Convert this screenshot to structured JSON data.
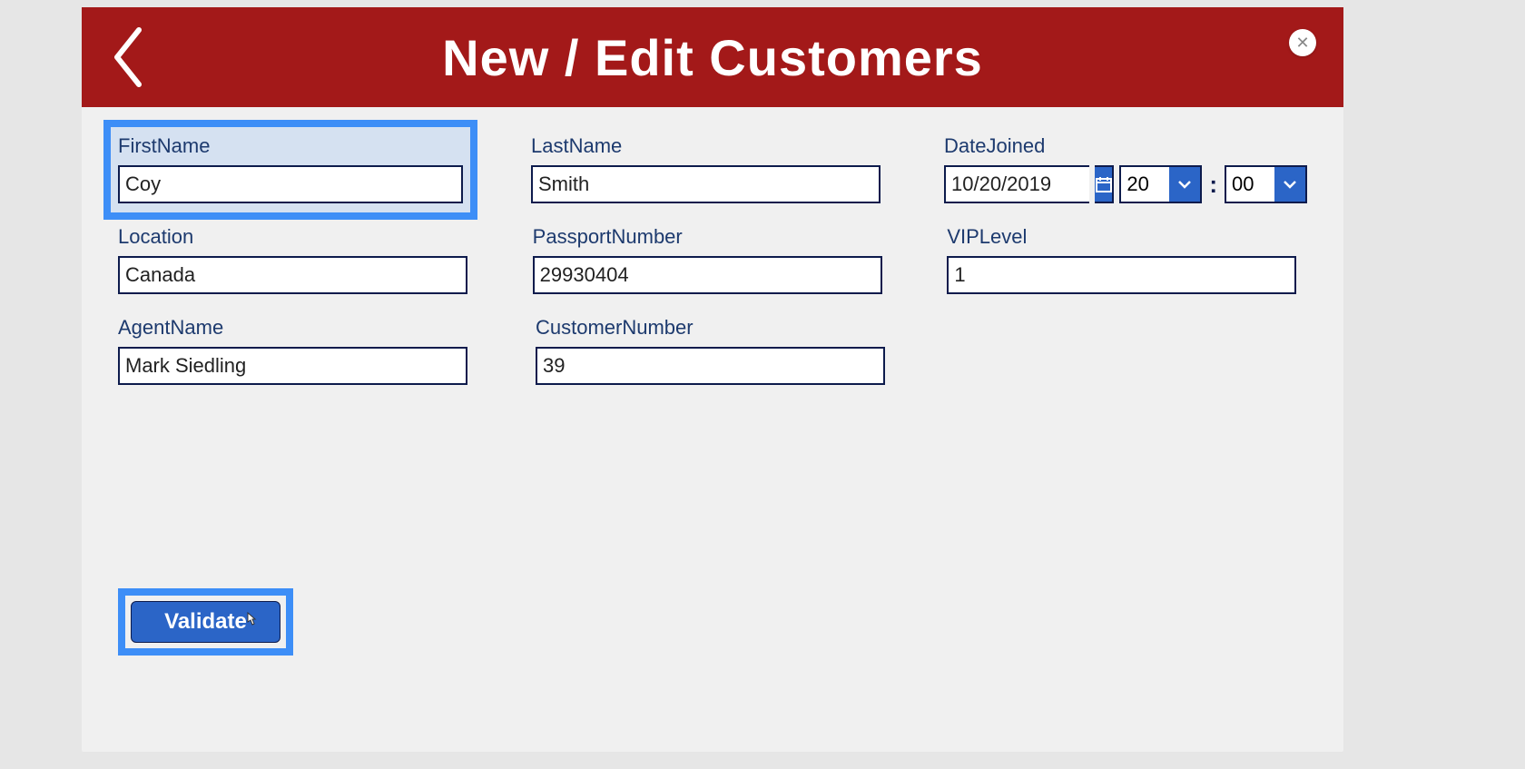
{
  "header": {
    "title": "New / Edit Customers"
  },
  "fields": {
    "firstName": {
      "label": "FirstName",
      "value": "Coy"
    },
    "lastName": {
      "label": "LastName",
      "value": "Smith"
    },
    "dateJoined": {
      "label": "DateJoined",
      "date": "10/20/2019",
      "hour": "20",
      "minute": "00"
    },
    "location": {
      "label": "Location",
      "value": "Canada"
    },
    "passportNumber": {
      "label": "PassportNumber",
      "value": "29930404"
    },
    "vipLevel": {
      "label": "VIPLevel",
      "value": "1"
    },
    "agentName": {
      "label": "AgentName",
      "value": "Mark Siedling"
    },
    "customerNumber": {
      "label": "CustomerNumber",
      "value": "39"
    }
  },
  "buttons": {
    "validate": "Validate"
  }
}
